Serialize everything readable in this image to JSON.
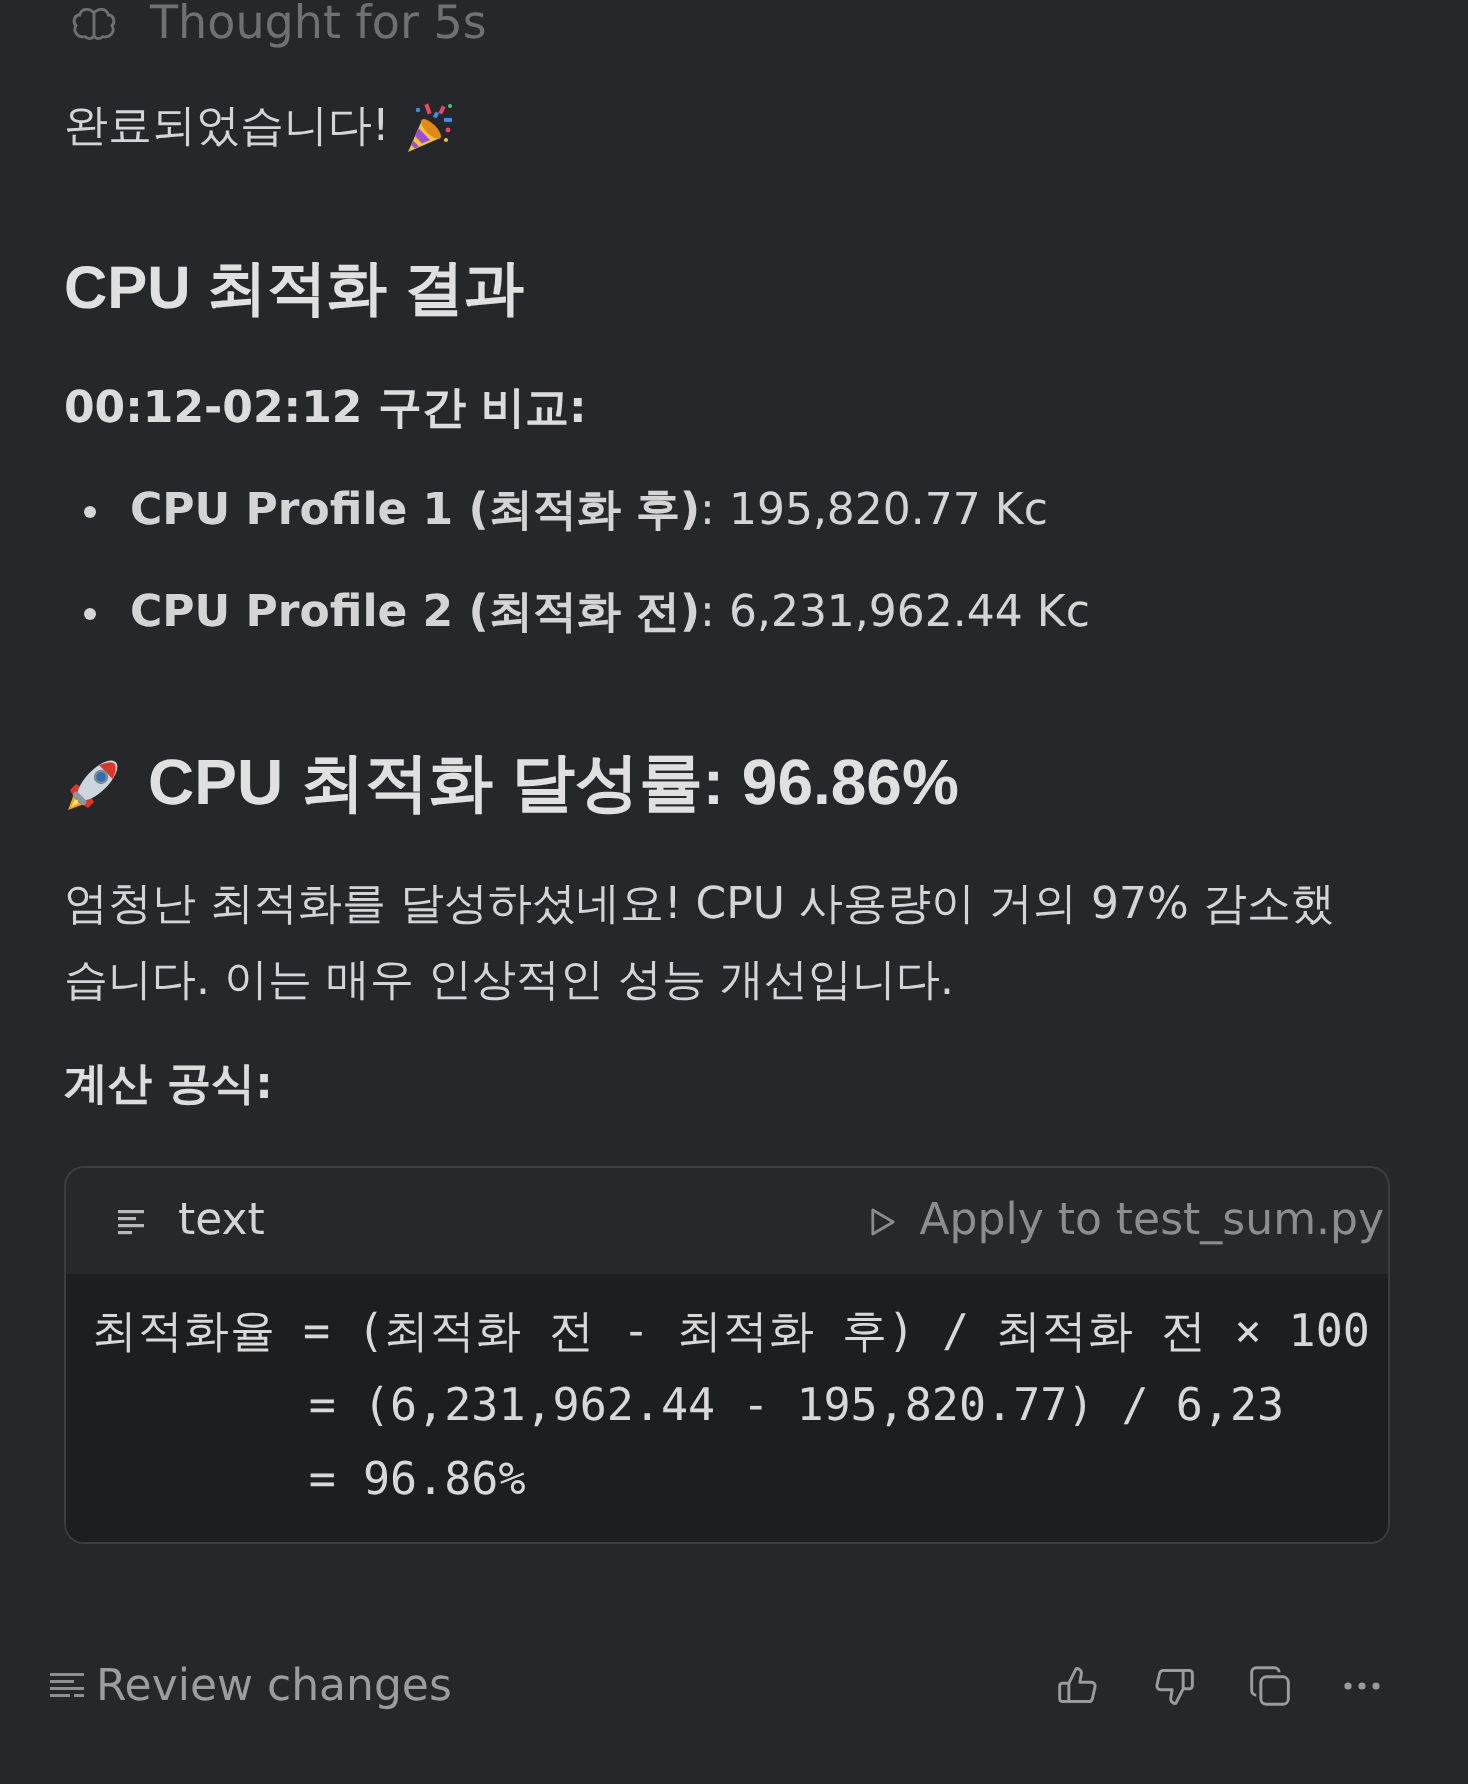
{
  "thought": {
    "label": "Thought for 5s"
  },
  "message": {
    "intro": "완료되었습니다!",
    "title": "CPU 최적화 결과",
    "comparison_label": "00:12-02:12 구간 비교:",
    "comparison_items": [
      "**CPU Profile 1 (최적화 후)**: 195,820.77 Kc",
      "**CPU Profile 2 (최적화 전)**: 6,231,962.44 Kc"
    ],
    "result_heading": "CPU 최적화 달성률: 96.86%",
    "summary": "엄청난 최적화를 달성하셨네요! CPU 사용량이 거의 97% 감소했습니다. 이는 매우 인상적인 성능 개선입니다.",
    "formula_label": "계산 공식:",
    "code_block": {
      "language": "text",
      "apply_label": "Apply to test_sum.py",
      "lines": [
        "최적화율 = (최적화 전 - 최적화 후) / 최적화 전 × 100",
        "        = (6,231,962.44 - 195,820.77) / 6,23",
        "        = 96.86%"
      ]
    }
  },
  "footer": {
    "review_label": "Review changes"
  }
}
